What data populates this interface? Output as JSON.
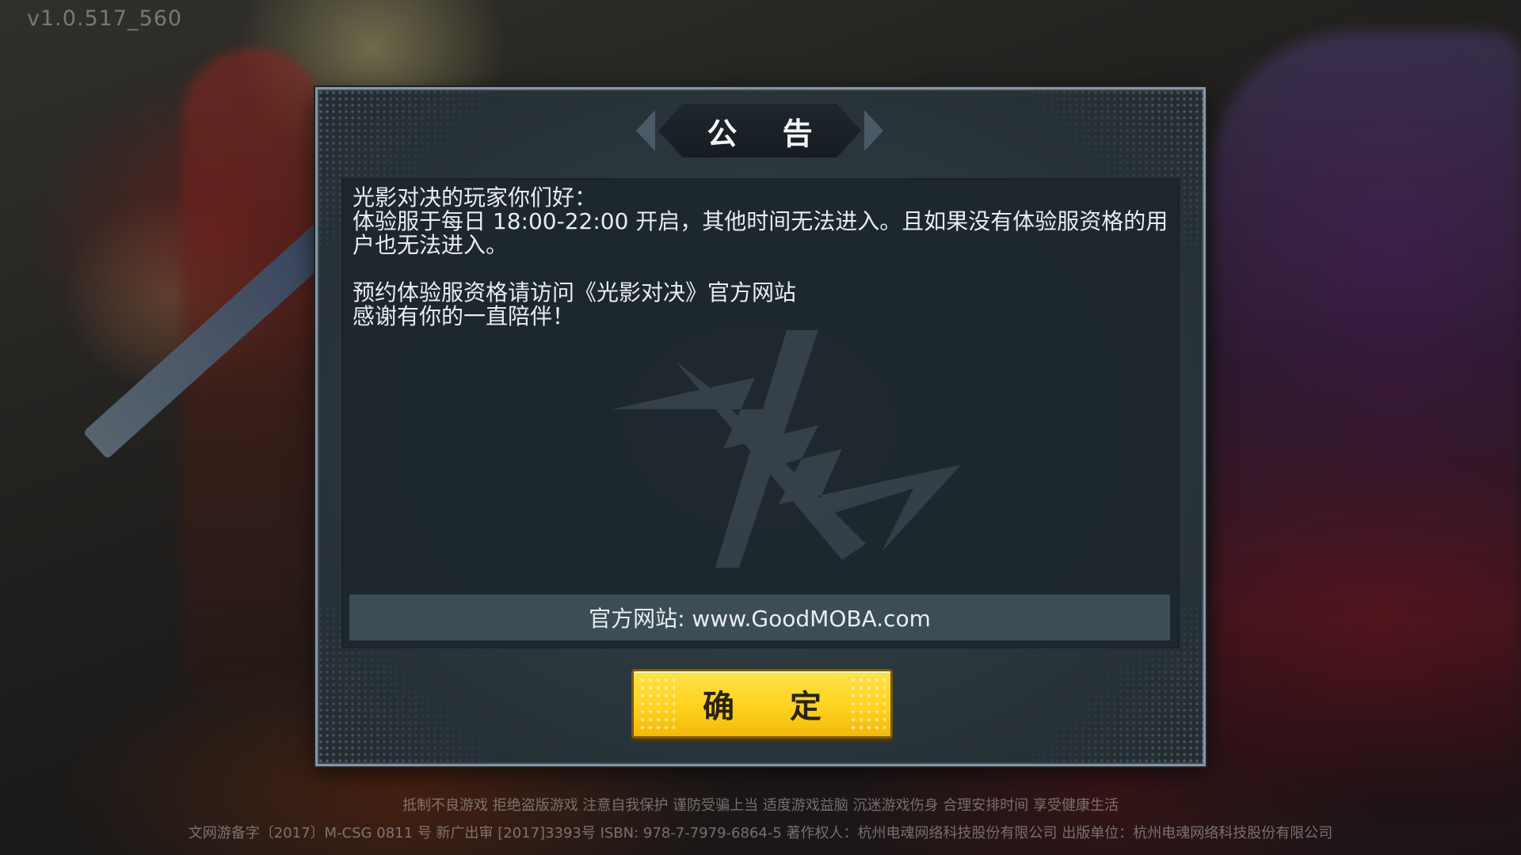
{
  "version": "v1.0.517_560",
  "dialog": {
    "title": "公 告",
    "notice_text": "光影对决的玩家你们好：\n体验服于每日 18:00-22:00 开启，其他时间无法进入。且如果没有体验服资格的用户也无法进入。\n\n预约体验服资格请访问《光影对决》官方网站\n感谢有你的一直陪伴！",
    "website": "官方网站: www.GoodMOBA.com",
    "confirm_label": "确 定"
  },
  "footer": {
    "health_notice": "抵制不良游戏 拒绝盗版游戏 注意自我保护 谨防受骗上当 适度游戏益脑 沉迷游戏伤身 合理安排时间 享受健康生活",
    "license_info": "文网游备字〔2017〕M-CSG 0811 号 新广出审 [2017]3393号 ISBN: 978-7-7979-6864-5 著作权人：杭州电魂网络科技股份有限公司 出版单位：杭州电魂网络科技股份有限公司"
  },
  "colors": {
    "confirm_button": "#ffd21e",
    "dialog_border": "#8a96a4",
    "panel_bg": "#1c262c",
    "website_bar": "#3d4d56"
  }
}
